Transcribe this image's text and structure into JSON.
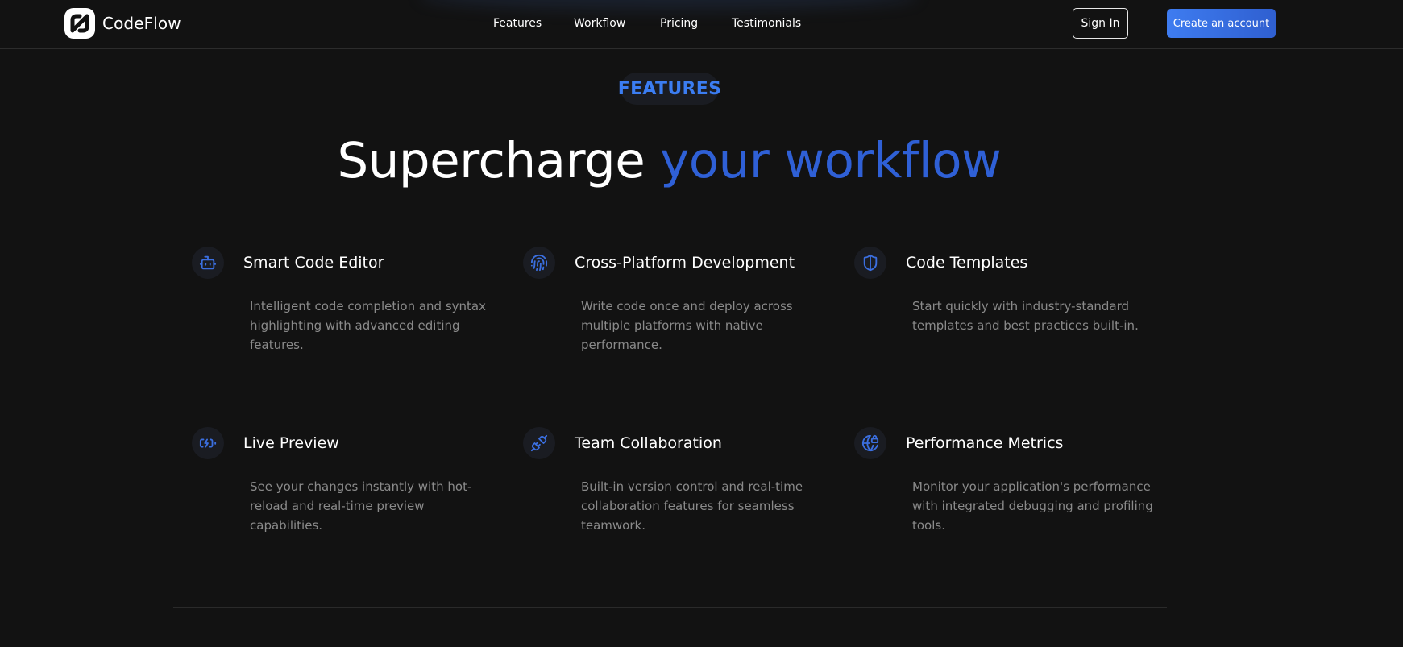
{
  "brand": {
    "name": "CodeFlow"
  },
  "nav": {
    "links": [
      {
        "label": "Features"
      },
      {
        "label": "Workflow"
      },
      {
        "label": "Pricing"
      },
      {
        "label": "Testimonials"
      }
    ],
    "sign_in_label": "Sign In",
    "create_account_label": "Create an account"
  },
  "section": {
    "eyebrow": "FEATURES",
    "headline_main": "Supercharge ",
    "headline_accent": "your workflow"
  },
  "features": [
    {
      "icon": "bot-icon",
      "title": "Smart Code Editor",
      "description": "Intelligent code completion and syntax highlighting with advanced editing features."
    },
    {
      "icon": "fingerprint-icon",
      "title": "Cross-Platform Development",
      "description": "Write code once and deploy across multiple platforms with native performance."
    },
    {
      "icon": "shield-icon",
      "title": "Code Templates",
      "description": "Start quickly with industry-standard templates and best practices built-in."
    },
    {
      "icon": "battery-charging-icon",
      "title": "Live Preview",
      "description": "See your changes instantly with hot-reload and real-time preview capabilities."
    },
    {
      "icon": "plug-icon",
      "title": "Team Collaboration",
      "description": "Built-in version control and real-time collaboration features for seamless teamwork."
    },
    {
      "icon": "globe-lock-icon",
      "title": "Performance Metrics",
      "description": "Monitor your application's performance with integrated debugging and profiling tools."
    }
  ],
  "colors": {
    "background": "#121212",
    "accent": "#3b7df2",
    "accent_dark": "#2f60d6",
    "muted_text": "#8a8a8a",
    "icon_bg": "#1a1c22"
  }
}
